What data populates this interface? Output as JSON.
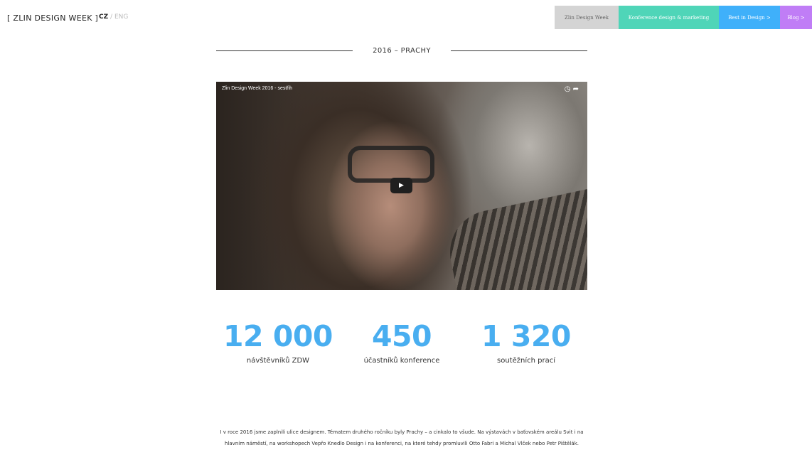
{
  "header": {
    "logo_text": "[ ZLIN DESIGN WEEK ]",
    "lang_active": "CZ",
    "lang_separator": "/",
    "lang_other": "ENG"
  },
  "topnav": {
    "items": [
      {
        "label": "Zlin Design Week",
        "color": "#d4d4d4"
      },
      {
        "label": "Konference design & marketing",
        "color": "#4fd5b8"
      },
      {
        "label": "Best in Design >",
        "color": "#3fb0fa"
      },
      {
        "label": "Blog >",
        "color": "#c07df6"
      }
    ]
  },
  "section": {
    "title": "2016 – PRACHY"
  },
  "video": {
    "title": "Zlin Design Week 2016 - sestřih",
    "icons": [
      "clock-icon",
      "share-icon",
      "play-icon"
    ]
  },
  "stats": [
    {
      "value": "12 000",
      "label": "návštěvníků ZDW"
    },
    {
      "value": "450",
      "label": "účastníků konference"
    },
    {
      "value": "1 320",
      "label": "soutěžních prací"
    }
  ],
  "accent_color": "#49aef0",
  "description": "I v roce 2016 jsme zaplnili ulice designem. Tématem druhého ročníku byly Prachy – a cinkalo to všude. Na výstavách v baťovském areálu Svit i na hlavním náměstí, na workshopech Vepřo Knedlo Design i na konferenci, na které tehdy promluvili Otto Fabri a Michal Vlček nebo Petr Pištělák."
}
